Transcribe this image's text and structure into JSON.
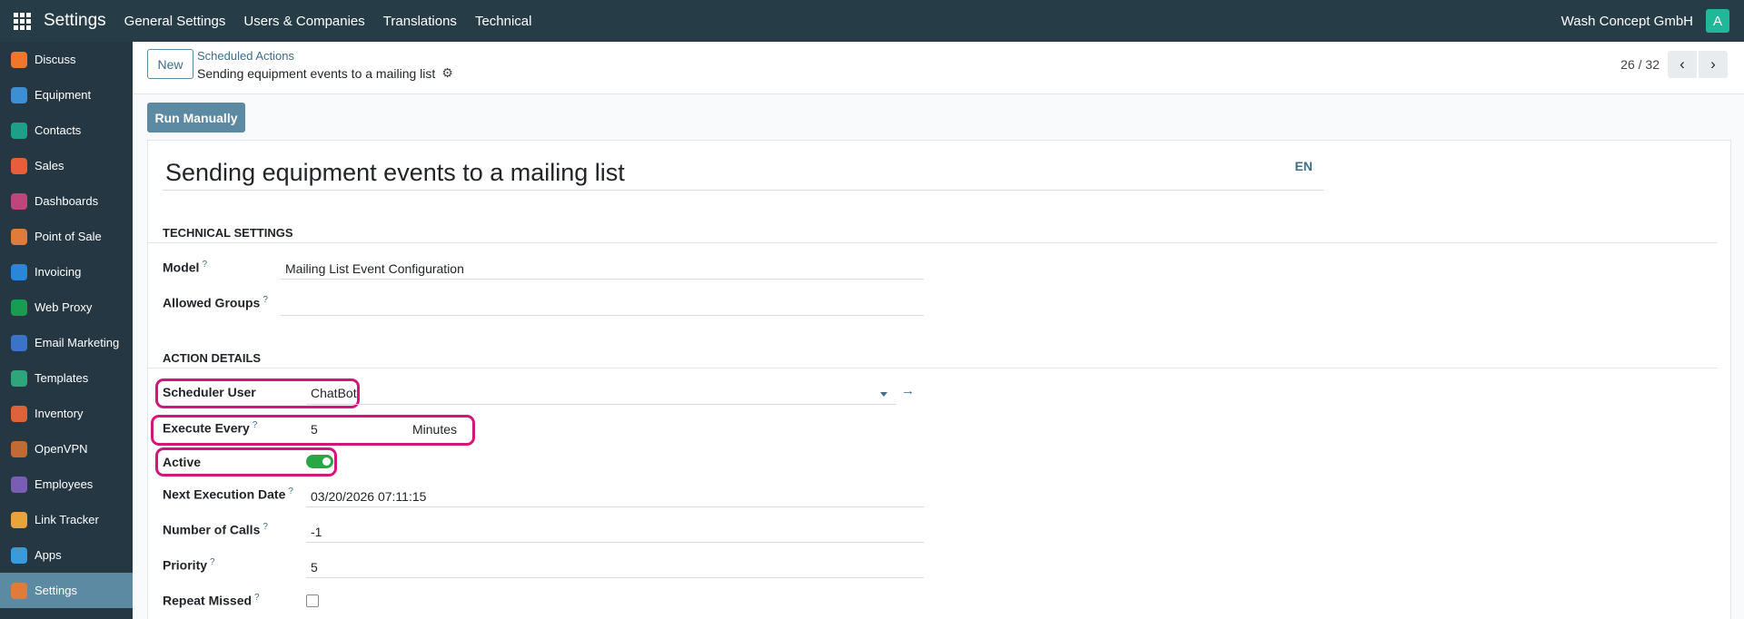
{
  "topbar": {
    "brand": "Settings",
    "menu": [
      "General Settings",
      "Users & Companies",
      "Translations",
      "Technical"
    ],
    "company": "Wash Concept GmbH",
    "avatar_letter": "A",
    "avatar_color": "#21b799"
  },
  "sidebar": {
    "items": [
      {
        "label": "Discuss",
        "icon": "discuss-icon",
        "color": "#f0762e"
      },
      {
        "label": "Equipment",
        "icon": "equipment-icon",
        "color": "#3d8fd1"
      },
      {
        "label": "Contacts",
        "icon": "contacts-icon",
        "color": "#1f9e8c"
      },
      {
        "label": "Sales",
        "icon": "sales-icon",
        "color": "#e85d3a"
      },
      {
        "label": "Dashboards",
        "icon": "dashboards-icon",
        "color": "#c0457a"
      },
      {
        "label": "Point of Sale",
        "icon": "point-of-sale-icon",
        "color": "#e07b39"
      },
      {
        "label": "Invoicing",
        "icon": "invoicing-icon",
        "color": "#2a86d8"
      },
      {
        "label": "Web Proxy",
        "icon": "web-proxy-icon",
        "color": "#1a9b52"
      },
      {
        "label": "Email Marketing",
        "icon": "email-marketing-icon",
        "color": "#3a73c8"
      },
      {
        "label": "Templates",
        "icon": "templates-icon",
        "color": "#2fa57c"
      },
      {
        "label": "Inventory",
        "icon": "inventory-icon",
        "color": "#e0623a"
      },
      {
        "label": "OpenVPN",
        "icon": "openvpn-icon",
        "color": "#c06a36"
      },
      {
        "label": "Employees",
        "icon": "employees-icon",
        "color": "#7a5db5"
      },
      {
        "label": "Link Tracker",
        "icon": "link-tracker-icon",
        "color": "#e8a43a"
      },
      {
        "label": "Apps",
        "icon": "apps-icon",
        "color": "#3a9bd8"
      },
      {
        "label": "Settings",
        "icon": "settings-icon",
        "color": "#e07b39"
      }
    ],
    "active_index": 15
  },
  "control": {
    "new_label": "New",
    "breadcrumb": "Scheduled Actions",
    "record_name": "Sending equipment events to a mailing list",
    "pager": "26 / 32"
  },
  "statusbar": {
    "run_label": "Run Manually"
  },
  "form": {
    "title": "Sending equipment events to a mailing list",
    "lang": "EN",
    "technical_title": "Technical Settings",
    "model_label": "Model",
    "model_value": "Mailing List Event Configuration",
    "groups_label": "Allowed Groups",
    "action_title": "Action Details",
    "scheduler_label": "Scheduler User",
    "scheduler_value": "ChatBot",
    "execute_label": "Execute Every",
    "execute_value": "5",
    "execute_unit": "Minutes",
    "active_label": "Active",
    "active": true,
    "next_date_label": "Next Execution Date",
    "next_date_value": "03/20/2026 07:11:15",
    "calls_label": "Number of Calls",
    "calls_value": "-1",
    "priority_label": "Priority",
    "priority_value": "5",
    "repeat_label": "Repeat Missed",
    "repeat_missed": false
  },
  "colors": {
    "highlight": "#d4167b",
    "toggle_on": "#28a745",
    "accent": "#5b8aa2"
  }
}
